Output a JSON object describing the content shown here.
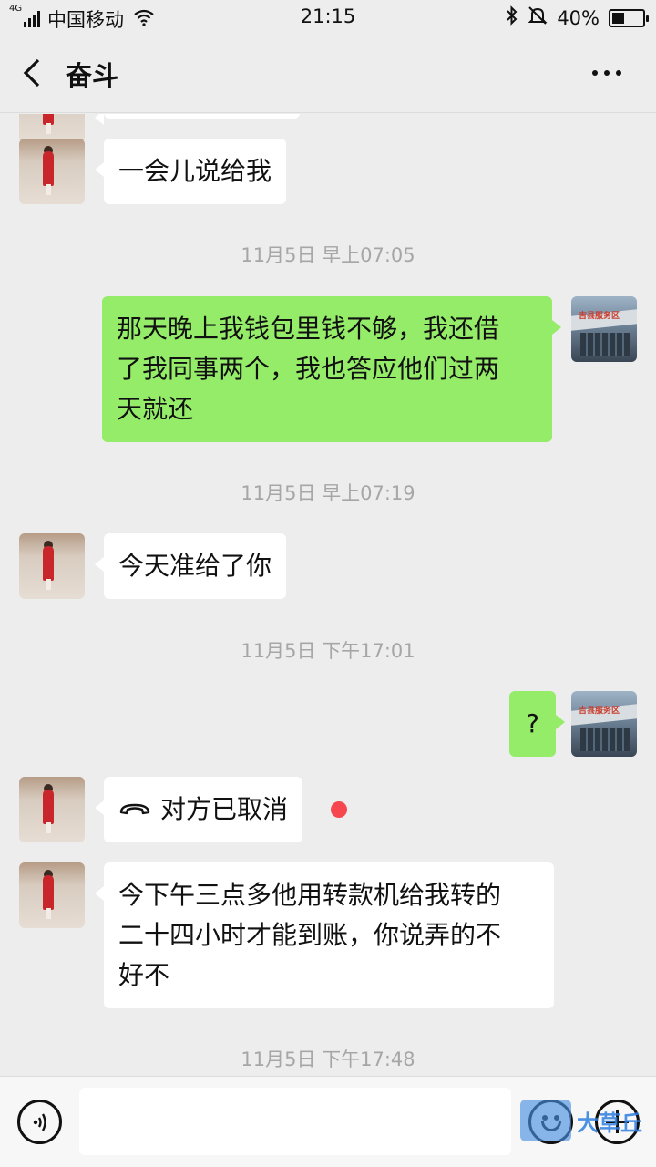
{
  "status_bar": {
    "network": "4G",
    "carrier": "中国移动",
    "time": "21:15",
    "battery": "40%",
    "battery_level": 0.4,
    "icons": [
      "signal-icon",
      "wifi-icon",
      "bluetooth-icon",
      "mute-bell-icon",
      "battery-icon"
    ]
  },
  "header": {
    "title": "奋斗",
    "back_icon": "chevron-left-icon",
    "more_icon": "more-dots-icon"
  },
  "messages": [
    {
      "type": "text",
      "side": "in",
      "text": "一会儿说给我"
    },
    {
      "type": "time",
      "text": "11月5日 早上07:05"
    },
    {
      "type": "text",
      "side": "out",
      "lines": [
        "那天晚上我钱包里钱不够，我还借",
        "了我同事两个，我也答应他们过两",
        "天就还"
      ]
    },
    {
      "type": "time",
      "text": "11月5日 早上07:19"
    },
    {
      "type": "text",
      "side": "in",
      "text": "今天准给了你"
    },
    {
      "type": "time",
      "text": "11月5日 下午17:01"
    },
    {
      "type": "text",
      "side": "out",
      "text": "?"
    },
    {
      "type": "call",
      "side": "in",
      "text": "对方已取消",
      "icon": "phone-hangup-icon",
      "unread": true
    },
    {
      "type": "text",
      "side": "in",
      "lines": [
        "今下午三点多他用转款机给我转的",
        "二十四小时才能到账，你说弄的不",
        "好不"
      ]
    },
    {
      "type": "time",
      "text": "11月5日 下午17:48"
    }
  ],
  "avatar_me_sign": "吉县服务区",
  "input_bar": {
    "voice_icon": "voice-icon",
    "placeholder": "",
    "emoji_icon": "emoji-icon",
    "plus_icon": "plus-icon"
  },
  "watermark": "大草丘"
}
